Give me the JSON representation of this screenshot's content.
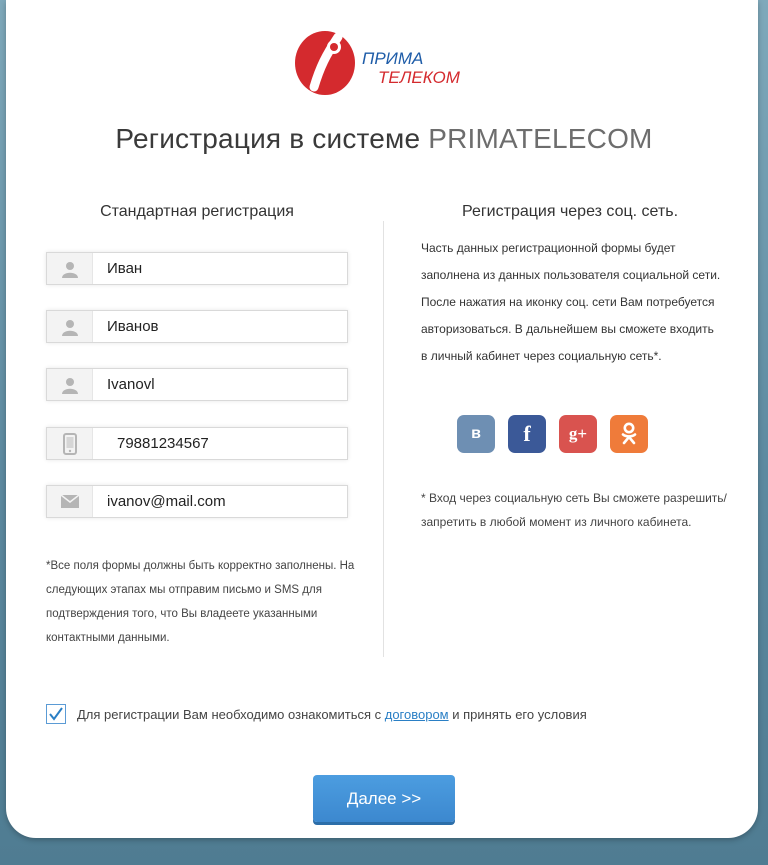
{
  "brand": {
    "logo_line1": "ПРИМА",
    "logo_line2": "ТЕЛЕКОМ",
    "colors": {
      "red": "#d42a2e",
      "accent_blue": "#3c88cf"
    }
  },
  "page": {
    "title_main": "Регистрация в системе ",
    "title_brand": "PRIMATELECOM"
  },
  "left": {
    "title": "Стандартная регистрация",
    "fields": [
      {
        "icon": "user-icon",
        "value": "Иван"
      },
      {
        "icon": "user-icon",
        "value": "Иванов"
      },
      {
        "icon": "user-icon",
        "value": "Ivanovl"
      },
      {
        "icon": "phone-icon",
        "value": "79881234567"
      },
      {
        "icon": "mail-icon",
        "value": "ivanov@mail.com"
      }
    ],
    "note": "*Все поля формы должны быть корректно заполнены. На следующих этапах мы отправим письмо и SMS для подтверждения того, что Вы владеете указанными контактными данными."
  },
  "right": {
    "title": "Регистрация через соц. сеть.",
    "text": "Часть данных регистрационной формы будет заполнена из данных пользователя социальной сети. После нажатия на иконку соц. сети Вам потребуется авторизоваться. В дальнейшем вы сможете входить в личный кабинет через социальную сеть*.",
    "socials": [
      {
        "name": "vk-icon",
        "glyph": "в"
      },
      {
        "name": "facebook-icon",
        "glyph": "f"
      },
      {
        "name": "google-plus-icon",
        "glyph": "g+"
      },
      {
        "name": "odnoklassniki-icon",
        "glyph": "ok"
      }
    ],
    "note": "* Вход через социальную сеть Вы сможете разрешить/запретить в любой момент из личного кабинета."
  },
  "agreement": {
    "checked": true,
    "text_before": "Для регистрации Вам необходимо ознакомиться с ",
    "link": "договором",
    "text_after": " и принять его условия"
  },
  "actions": {
    "next_label": "Далее >>"
  }
}
